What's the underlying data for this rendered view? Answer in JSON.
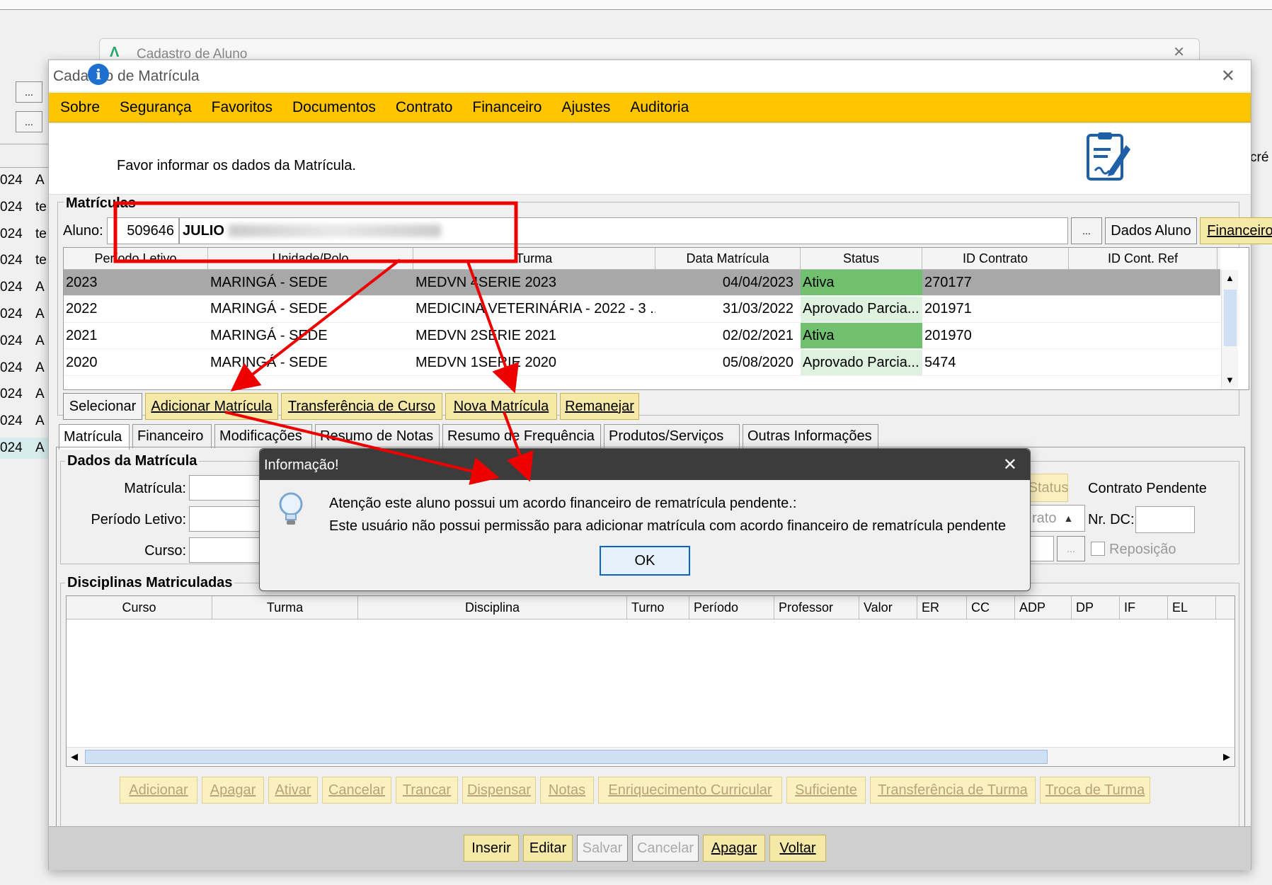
{
  "bg_window": {
    "title": "Cadastro de Aluno",
    "rows": [
      "024",
      "024",
      "024",
      "024",
      "024",
      "024",
      "024",
      "024",
      "024",
      "024",
      "024"
    ],
    "row_suffix": [
      "A",
      "te",
      "te",
      "te",
      "A",
      "A",
      "A",
      "A",
      "A",
      "A",
      "A"
    ],
    "right_text": "cré",
    "ellipsis": "..."
  },
  "window": {
    "title": "Cadastro de Matrícula",
    "close": "✕"
  },
  "menu": [
    "Sobre",
    "Segurança",
    "Favoritos",
    "Documentos",
    "Contrato",
    "Financeiro",
    "Ajustes",
    "Auditoria"
  ],
  "info_text": "Favor informar os dados da Matrícula.",
  "matriculas": {
    "legend": "Matrículas",
    "aluno_label": "Aluno:",
    "aluno_id": "509646",
    "aluno_name": "JULIO",
    "ellipsis_btn": "...",
    "dados_aluno_btn": "Dados Aluno",
    "financeiro_btn": "Financeiro",
    "columns": [
      "Período Letivo",
      "Unidade/Polo",
      "Turma",
      "Data Matrícula",
      "Status",
      "ID Contrato",
      "ID Cont. Ref"
    ],
    "rows": [
      {
        "periodo": "2023",
        "unidade": "MARINGÁ - SEDE",
        "turma": "MEDVN 4SERIE 2023",
        "data": "04/04/2023",
        "status": "Ativa",
        "contrato": "270177",
        "ref": ""
      },
      {
        "periodo": "2022",
        "unidade": "MARINGÁ - SEDE",
        "turma": "MEDICINA VETERINÁRIA - 2022 - 3 ...",
        "data": "31/03/2022",
        "status": "Aprovado Parcia...",
        "contrato": "201971",
        "ref": ""
      },
      {
        "periodo": "2021",
        "unidade": "MARINGÁ - SEDE",
        "turma": "MEDVN 2SERIE 2021",
        "data": "02/02/2021",
        "status": "Ativa",
        "contrato": "201970",
        "ref": ""
      },
      {
        "periodo": "2020",
        "unidade": "MARINGÁ - SEDE",
        "turma": "MEDVN 1SERIE 2020",
        "data": "05/08/2020",
        "status": "Aprovado Parcia...",
        "contrato": "5474",
        "ref": ""
      }
    ],
    "actions": [
      "Selecionar",
      "Adicionar Matrícula",
      "Transferência de Curso",
      "Nova Matrícula",
      "Remanejar"
    ]
  },
  "tabs": [
    "Matrícula",
    "Financeiro",
    "Modificações",
    "Resumo de Notas",
    "Resumo de Frequência",
    "Produtos/Serviços",
    "Outras Informações"
  ],
  "dados": {
    "legend": "Dados da Matrícula",
    "matricula_label": "Matrícula:",
    "periodo_label": "Período Letivo:",
    "curso_label": "Curso:",
    "status_btn": "Status",
    "contrato_pendente": "Contrato Pendente",
    "rato_text": "rato",
    "nr_dc_label": "Nr. DC:",
    "reposicao_label": "Reposição",
    "ellipsis": "..."
  },
  "disciplinas": {
    "legend": "Disciplinas Matriculadas",
    "columns": [
      "Curso",
      "Turma",
      "Disciplina",
      "Turno",
      "Período",
      "Professor",
      "Valor",
      "ER",
      "CC",
      "ADP",
      "DP",
      "IF",
      "EL"
    ],
    "actions": [
      "Adicionar",
      "Apagar",
      "Ativar",
      "Cancelar",
      "Trancar",
      "Dispensar",
      "Notas",
      "Enriquecimento Curricular",
      "Suficiente",
      "Transferência de Turma",
      "Troca de Turma"
    ]
  },
  "footer": [
    "Inserir",
    "Editar",
    "Salvar",
    "Cancelar",
    "Apagar",
    "Voltar"
  ],
  "dialog": {
    "title": "Informação!",
    "line1": "Atenção este aluno possui um acordo financeiro de rematrícula pendente.:",
    "line2": "Este usuário não possui permissão para adicionar matrícula com acordo financeiro de rematrícula pendente",
    "ok": "OK",
    "close": "✕"
  },
  "colors": {
    "menu_bg": "#ffc600",
    "status_green": "#70c070",
    "selected_row": "#a8a8a8",
    "dialog_title_bg": "#3c3c3c",
    "annotation": "#ee0000"
  }
}
